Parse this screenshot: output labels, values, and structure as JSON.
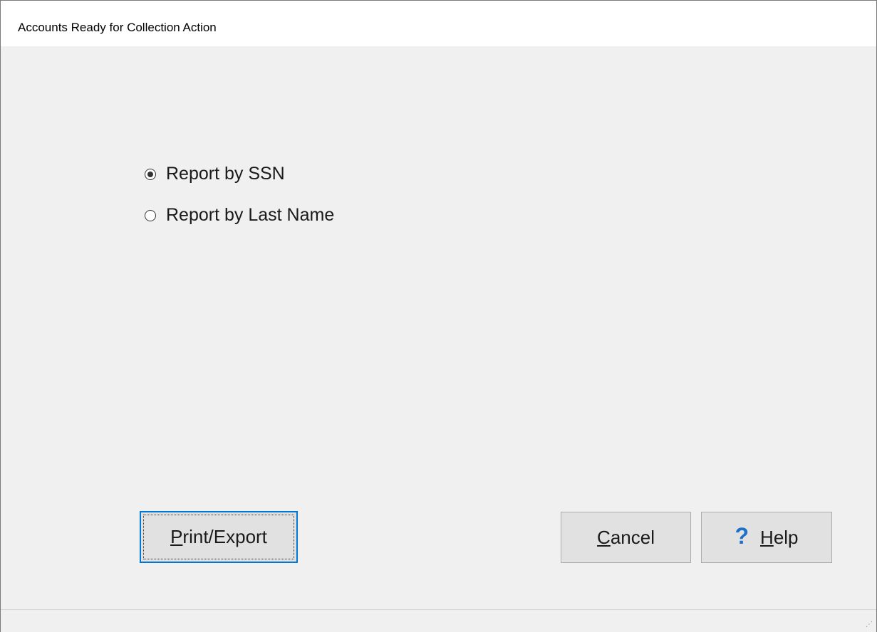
{
  "window": {
    "title": "Accounts Ready for Collection Action"
  },
  "report_options": [
    {
      "label": "Report by SSN",
      "selected": true
    },
    {
      "label": "Report by Last Name",
      "selected": false
    }
  ],
  "buttons": {
    "print_export": {
      "mnemonic": "P",
      "rest": "rint/Export"
    },
    "cancel": {
      "mnemonic": "C",
      "rest": "ancel"
    },
    "help": {
      "icon": "?",
      "mnemonic": "H",
      "rest": "elp"
    }
  },
  "colors": {
    "background": "#f0f0f0",
    "focus_border": "#0078d7",
    "help_icon": "#1e6fc9"
  }
}
